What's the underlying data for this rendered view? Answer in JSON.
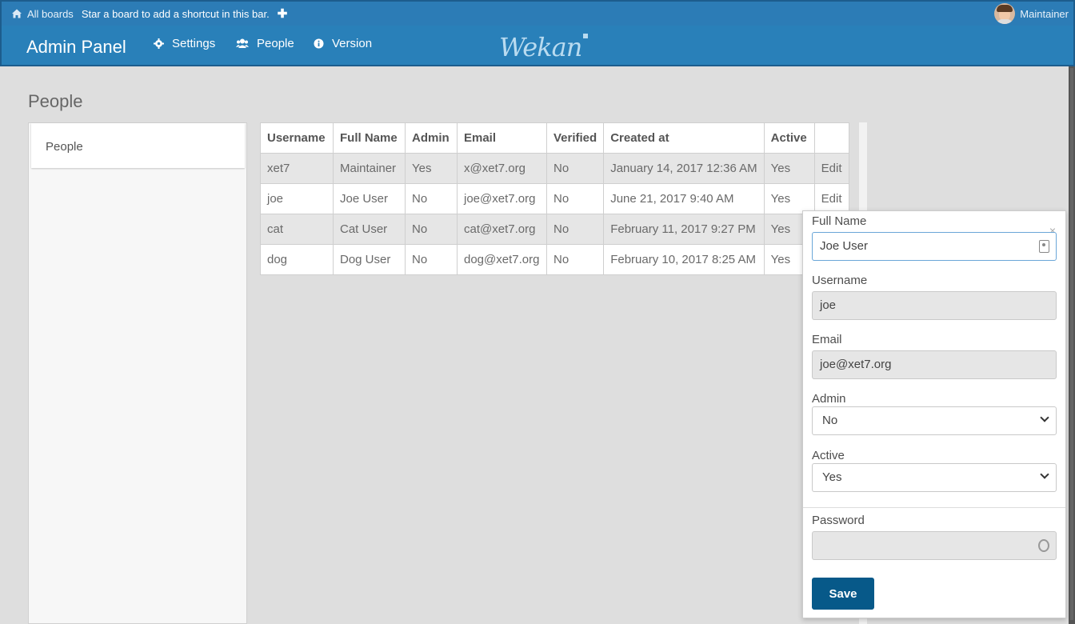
{
  "topbar": {
    "all_boards": "All boards",
    "hint": "Star a board to add a shortcut in this bar.",
    "plus": "✚",
    "user_name": "Maintainer"
  },
  "header": {
    "title": "Admin Panel",
    "nav": [
      {
        "label": "Settings",
        "icon": "gear-icon"
      },
      {
        "label": "People",
        "icon": "users-icon"
      },
      {
        "label": "Version",
        "icon": "info-icon"
      }
    ],
    "logo": "Wekan"
  },
  "page": {
    "title": "People",
    "sidebar_item": "People"
  },
  "table": {
    "headers": [
      "Username",
      "Full Name",
      "Admin",
      "Email",
      "Verified",
      "Created at",
      "Active",
      ""
    ],
    "rows": [
      [
        "xet7",
        "Maintainer",
        "Yes",
        "x@xet7.org",
        "No",
        "January 14, 2017 12:36 AM",
        "Yes",
        "Edit"
      ],
      [
        "joe",
        "Joe User",
        "No",
        "joe@xet7.org",
        "No",
        "June 21, 2017 9:40 AM",
        "Yes",
        "Edit"
      ],
      [
        "cat",
        "Cat User",
        "No",
        "cat@xet7.org",
        "No",
        "February 11, 2017 9:27 PM",
        "Yes",
        ""
      ],
      [
        "dog",
        "Dog User",
        "No",
        "dog@xet7.org",
        "No",
        "February 10, 2017 8:25 AM",
        "Yes",
        ""
      ]
    ]
  },
  "popup": {
    "close": "×",
    "fullname_label": "Full Name",
    "fullname_value": "Joe User",
    "username_label": "Username",
    "username_value": "joe",
    "email_label": "Email",
    "email_value": "joe@xet7.org",
    "admin_label": "Admin",
    "admin_value": "No",
    "active_label": "Active",
    "active_value": "Yes",
    "password_label": "Password",
    "password_value": "",
    "save_label": "Save"
  }
}
